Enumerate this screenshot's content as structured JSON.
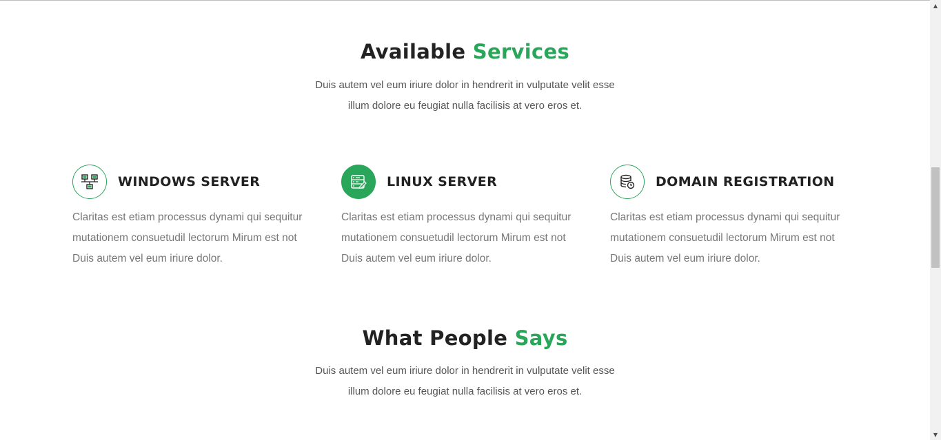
{
  "services_section": {
    "title_main": "Available",
    "title_accent": "Services",
    "desc_line1": "Duis autem vel eum iriure dolor in hendrerit in vulputate velit esse",
    "desc_line2": "illum dolore eu feugiat nulla facilisis at vero eros et."
  },
  "services": [
    {
      "icon": "server-network-icon",
      "title": "WINDOWS SERVER",
      "text_line1": "Claritas est etiam processus dynami qui sequitur",
      "text_line2": "mutationem consuetudil lectorum Mirum est not",
      "text_line3": "Duis autem vel eum iriure dolor."
    },
    {
      "icon": "server-list-icon",
      "title": "LINUX SERVER",
      "text_line1": "Claritas est etiam processus dynami qui sequitur",
      "text_line2": "mutationem consuetudil lectorum Mirum est not",
      "text_line3": "Duis autem vel eum iriure dolor."
    },
    {
      "icon": "database-clock-icon",
      "title": "DOMAIN REGISTRATION",
      "text_line1": "Claritas est etiam processus dynami qui sequitur",
      "text_line2": "mutationem consuetudil lectorum Mirum est not",
      "text_line3": "Duis autem vel eum iriure dolor."
    }
  ],
  "testimonials_section": {
    "title_main": "What People",
    "title_accent": "Says",
    "desc_line1": "Duis autem vel eum iriure dolor in hendrerit in vulputate velit esse",
    "desc_line2": "illum dolore eu feugiat nulla facilisis at vero eros et."
  },
  "colors": {
    "accent": "#2aa65a",
    "heading": "#222222",
    "body_text": "#777777"
  },
  "scrollbar": {
    "up_icon": "scroll-up-arrow-icon",
    "down_icon": "scroll-down-arrow-icon"
  }
}
